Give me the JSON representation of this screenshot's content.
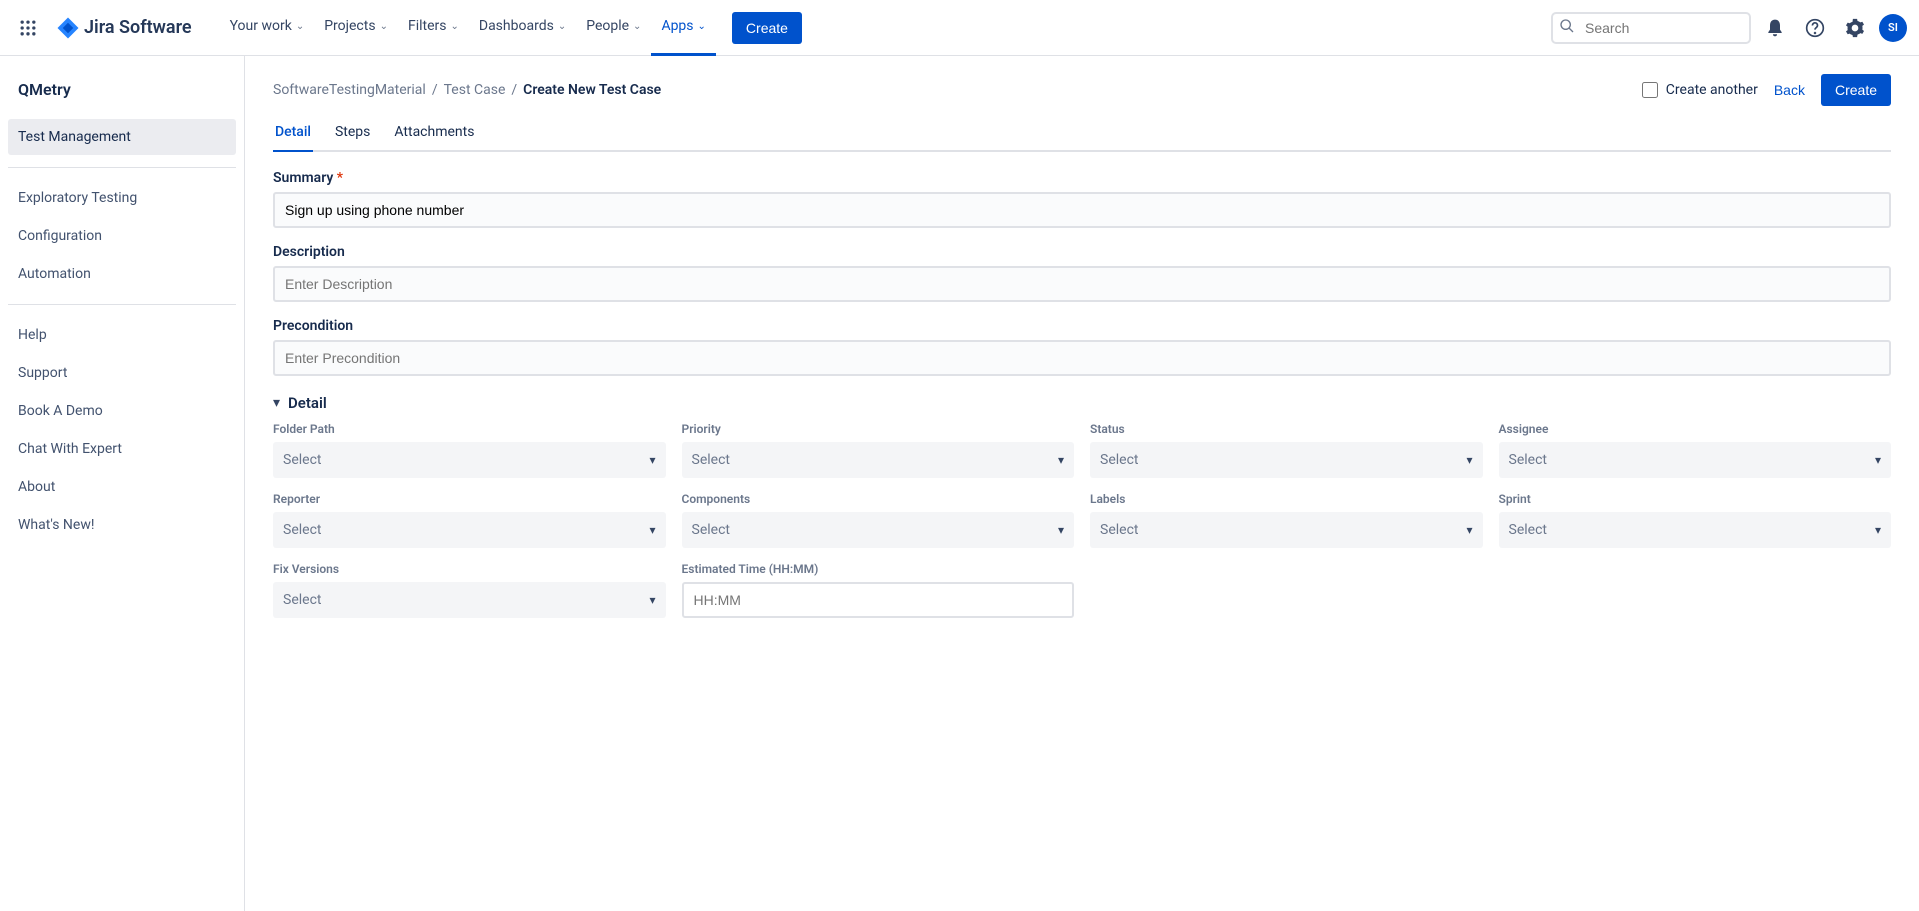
{
  "topnav": {
    "logo_text": "Jira Software",
    "items": [
      "Your work",
      "Projects",
      "Filters",
      "Dashboards",
      "People",
      "Apps"
    ],
    "active_index": 5,
    "create_label": "Create",
    "search_placeholder": "Search",
    "avatar_initials": "SI"
  },
  "sidebar": {
    "title": "QMetry",
    "groups": [
      [
        "Test Management"
      ],
      [
        "Exploratory Testing",
        "Configuration",
        "Automation"
      ],
      [
        "Help",
        "Support",
        "Book A Demo",
        "Chat With Expert",
        "About",
        "What's New!"
      ]
    ],
    "active": "Test Management"
  },
  "breadcrumb": {
    "items": [
      "SoftwareTestingMaterial",
      "Test Case",
      "Create New Test Case"
    ]
  },
  "actions": {
    "create_another": "Create another",
    "back": "Back",
    "create": "Create"
  },
  "tabs": {
    "items": [
      "Detail",
      "Steps",
      "Attachments"
    ],
    "active_index": 0
  },
  "form": {
    "summary_label": "Summary",
    "summary_value": "Sign up using phone number",
    "description_label": "Description",
    "description_placeholder": "Enter Description",
    "precondition_label": "Precondition",
    "precondition_placeholder": "Enter Precondition",
    "detail_section": "Detail",
    "select_placeholder": "Select",
    "fields_row1": [
      "Folder Path",
      "Priority",
      "Status",
      "Assignee"
    ],
    "fields_row2": [
      "Reporter",
      "Components",
      "Labels",
      "Sprint"
    ],
    "fix_versions_label": "Fix Versions",
    "estimated_time_label": "Estimated Time (HH:MM)",
    "estimated_time_placeholder": "HH:MM"
  }
}
